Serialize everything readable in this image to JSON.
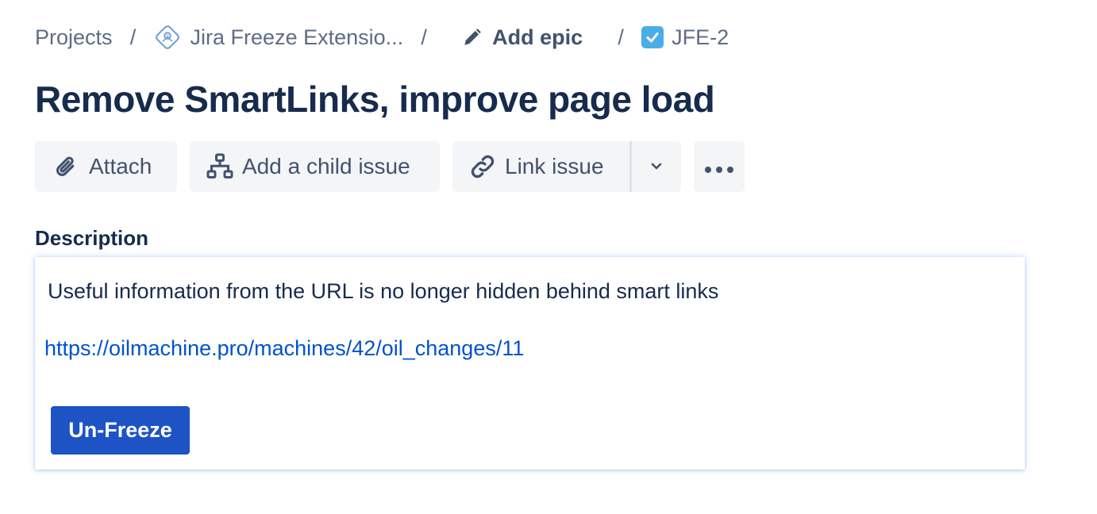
{
  "breadcrumb": {
    "projects": "Projects",
    "separator": "/",
    "project_name": "Jira Freeze Extensio...",
    "add_epic": "Add epic",
    "issue_key": "JFE-2"
  },
  "issue": {
    "title": "Remove SmartLinks, improve page load"
  },
  "toolbar": {
    "attach": "Attach",
    "add_child": "Add a child issue",
    "link_issue": "Link issue"
  },
  "description": {
    "heading": "Description",
    "text": "Useful information from the URL is no longer hidden behind smart links",
    "link": "https://oilmachine.pro/machines/42/oil_changes/11",
    "unfreeze_button": "Un-Freeze"
  },
  "icons": {
    "project": "project-diamond-icon",
    "pencil": "pencil-icon",
    "task_checkbox": "task-checkbox-icon",
    "attach": "paperclip-icon",
    "child_issue": "hierarchy-icon",
    "link": "link-icon",
    "dropdown": "chevron-down-icon",
    "more": "more-horizontal-icon"
  },
  "colors": {
    "primary_button": "#1d53c4",
    "link": "#0052cc",
    "text": "#172b4d",
    "muted": "#5e6c84",
    "toolbar_bg": "#f4f5f7",
    "task_icon": "#4bade8"
  }
}
